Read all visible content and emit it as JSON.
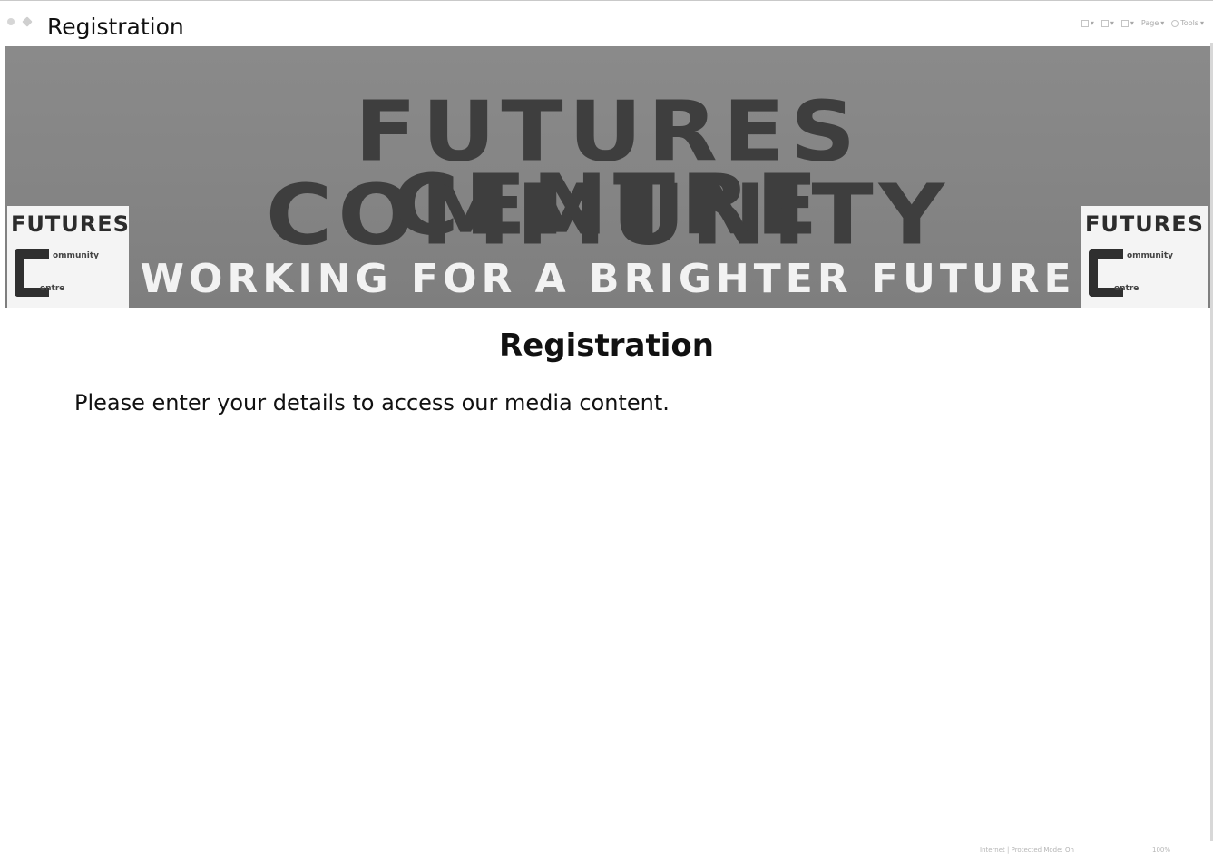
{
  "browser": {
    "tab_title": "Registration",
    "toolbar": {
      "page_label": "Page",
      "tools_label": "Tools"
    }
  },
  "banner": {
    "title_line1": "Futures Community",
    "title_line2": "Centre",
    "tagline": "Working for a brighter future",
    "logo": {
      "word": "Futures",
      "sub1": "ommunity",
      "sub2": "entre"
    }
  },
  "page": {
    "heading": "Registration",
    "intro": "Please enter your details to access our media content."
  },
  "statusbar": {
    "zone": "Internet | Protected Mode: On",
    "zoom": "100%"
  }
}
